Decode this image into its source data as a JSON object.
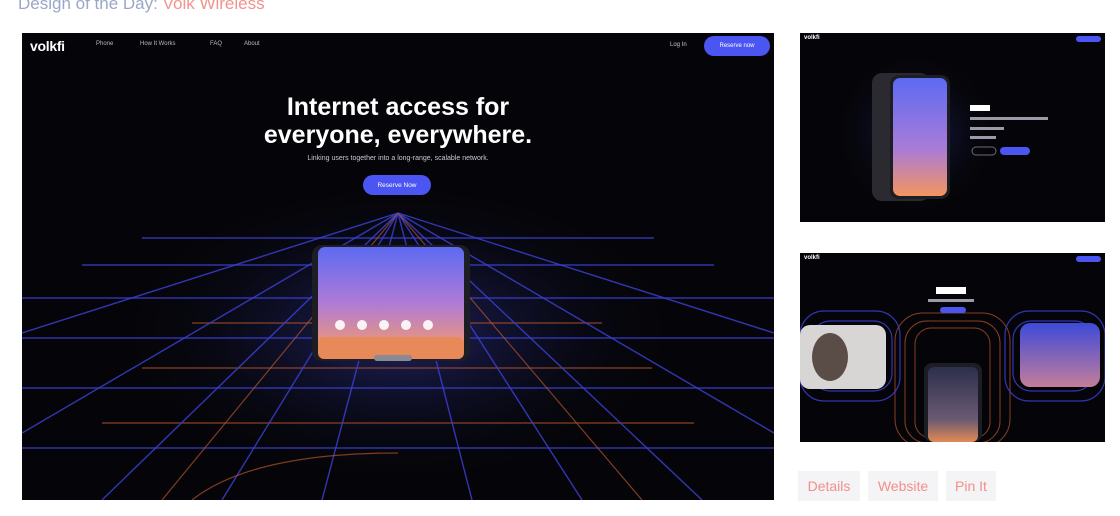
{
  "header": {
    "prefix": "Design of the Day:",
    "title": "Volk Wireless"
  },
  "main": {
    "logo": "volkfi",
    "nav": [
      "Phone",
      "How It Works",
      "FAQ",
      "About"
    ],
    "login": "Log In",
    "nav_button": "Reserve now",
    "headline_1": "Internet access for",
    "headline_2": "everyone, everywhere.",
    "subheadline": "Linking users together into a long-range, scalable network.",
    "hero_button": "Reserve Now"
  },
  "thumbnails": {
    "one": {
      "logo": "volkfi"
    },
    "two": {
      "logo": "volkfi"
    }
  },
  "actions": {
    "details": "Details",
    "website": "Website",
    "pin": "Pin It"
  },
  "colors": {
    "accent": "#4b55f2",
    "link": "#f28f88",
    "background": "#050509"
  }
}
